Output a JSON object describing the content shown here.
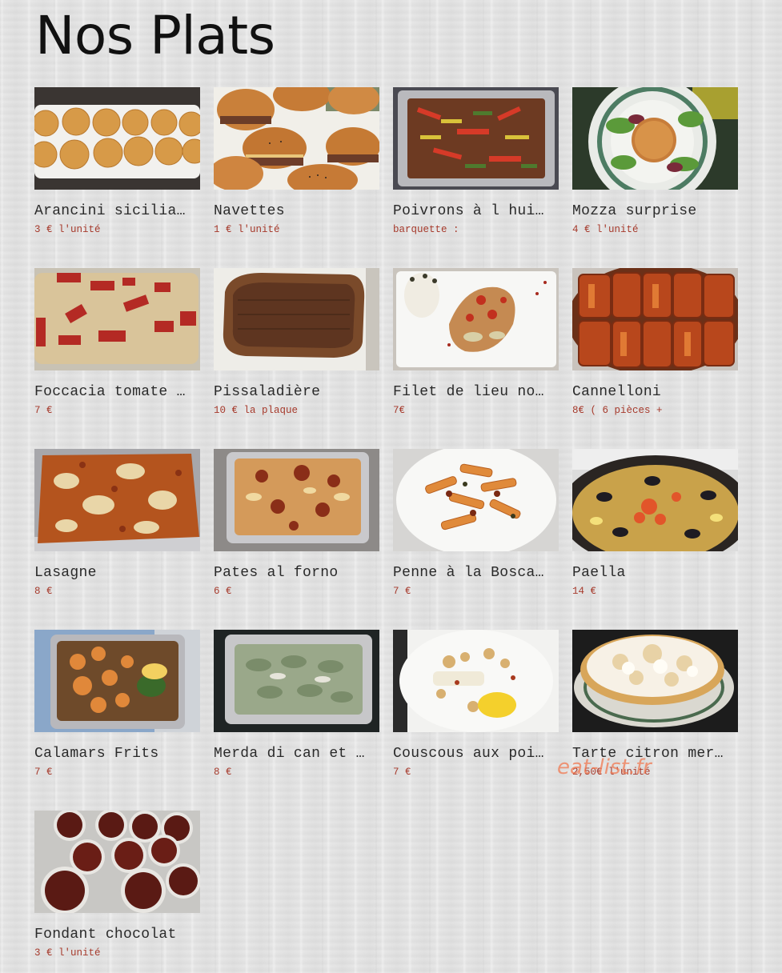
{
  "page_title": "Nos Plats",
  "watermark": "eat-list.fr",
  "colors": {
    "price": "#a63a2c",
    "title": "#111111",
    "background": "#e4e4e4"
  },
  "dishes": [
    {
      "name": "Arancini sicilia…",
      "price": "3 € l'unité",
      "photo": "arancini-rice-balls-photo"
    },
    {
      "name": "Navettes",
      "price": "1 € l'unité",
      "photo": "mini-burger-buns-photo"
    },
    {
      "name": "Poivrons à l hui…",
      "price": "barquette :",
      "photo": "peppers-in-oil-tray-photo"
    },
    {
      "name": "Mozza surprise",
      "price": "4 € l'unité",
      "photo": "breaded-mozzarella-salad-photo"
    },
    {
      "name": "Foccacia tomate …",
      "price": "7 €",
      "photo": "focaccia-tomato-photo"
    },
    {
      "name": "Pissaladière",
      "price": "10 € la plaque",
      "photo": "pissaladiere-photo"
    },
    {
      "name": "Filet de lieu no…",
      "price": "7€",
      "photo": "fish-filet-rice-photo"
    },
    {
      "name": "Cannelloni",
      "price": "8€ ( 6 pièces +",
      "photo": "cannelloni-dish-photo"
    },
    {
      "name": "Lasagne",
      "price": "8 €",
      "photo": "lasagne-tray-photo"
    },
    {
      "name": "Pates al forno",
      "price": "6 €",
      "photo": "baked-pasta-tray-photo"
    },
    {
      "name": "Penne à la Bosca…",
      "price": "7 €",
      "photo": "penne-plate-photo"
    },
    {
      "name": "Paella",
      "price": "14 €",
      "photo": "paella-pan-photo"
    },
    {
      "name": "Calamars Frits",
      "price": "7 €",
      "photo": "fried-calamari-tray-photo"
    },
    {
      "name": "Merda di can et …",
      "price": "8 €",
      "photo": "green-gnocchi-tray-photo"
    },
    {
      "name": "Couscous aux poi…",
      "price": "7 €",
      "photo": "fish-couscous-plate-photo"
    },
    {
      "name": "Tarte citron mer…",
      "price": "2,50€ l'unité",
      "photo": "lemon-meringue-tart-photo"
    },
    {
      "name": "Fondant chocolat",
      "price": "3 € l'unité",
      "photo": "chocolate-fondant-ramekins-photo"
    }
  ]
}
